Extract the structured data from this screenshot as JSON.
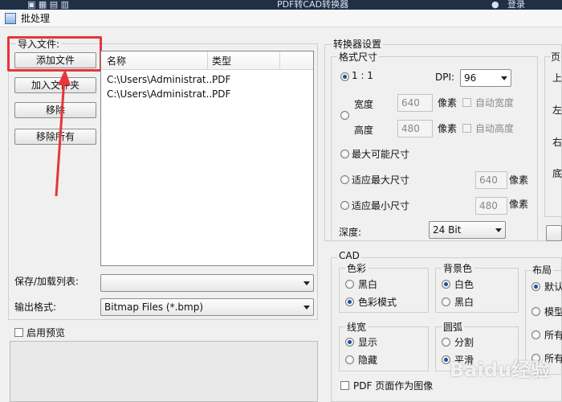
{
  "window": {
    "title_bar_text": "PDF转CAD转换器",
    "title_bar_user": "登录",
    "dialog_title": "批处理"
  },
  "import_section": {
    "title": "导入文件:",
    "buttons": {
      "add_file": "添加文件",
      "add_folder": "加入文件夹",
      "remove": "移除",
      "remove_all": "移除所有"
    }
  },
  "file_list": {
    "columns": [
      "名称",
      "类型"
    ],
    "rows": [
      {
        "name": "C:\\Users\\Administrat...",
        "type": "PDF"
      },
      {
        "name": "C:\\Users\\Administrat...",
        "type": "PDF"
      }
    ]
  },
  "list_controls": {
    "save_load_label": "保存/加载列表:",
    "save_load_value": "",
    "output_format_label": "输出格式:",
    "output_format_value": "Bitmap Files (*.bmp)"
  },
  "preview": {
    "enable_label": "启用预览"
  },
  "converter": {
    "title": "转换器设置",
    "format_size": {
      "title": "格式尺寸",
      "ratio_label": "1 : 1",
      "dpi_label": "DPI:",
      "dpi_value": "96",
      "width_label": "宽度",
      "width_value": "640",
      "width_unit": "像素",
      "auto_width": "自动宽度",
      "height_label": "高度",
      "height_value": "480",
      "height_unit": "像素",
      "auto_height": "自动高度",
      "max_possible": "最大可能尺寸",
      "fit_max": "适应最大尺寸",
      "fit_max_value": "640",
      "fit_max_unit": "像素",
      "fit_min": "适应最小尺寸",
      "fit_min_value": "480",
      "fit_min_unit": "像素",
      "depth_label": "深度:",
      "depth_value": "24 Bit"
    },
    "page_partial": {
      "title": "页",
      "top": "上",
      "left": "左",
      "right": "右",
      "bottom": "底"
    }
  },
  "cad": {
    "title": "CAD",
    "color": {
      "title": "色彩",
      "mono": "黑白",
      "color_mode": "色彩模式"
    },
    "background": {
      "title": "背景色",
      "white": "白色",
      "black": "黑白"
    },
    "layout": {
      "title": "布局",
      "default": "默认",
      "model": "模型",
      "all1": "所有",
      "all2": "所有"
    },
    "linewidth": {
      "title": "线宽",
      "show": "显示",
      "hide": "隐藏"
    },
    "arc": {
      "title": "圆弧",
      "split": "分割",
      "smooth": "平滑"
    },
    "pdf_page_as_image": "PDF 页面作为图像"
  },
  "watermark": "Baidu经验",
  "colors": {
    "highlight": "#e8343a",
    "arrow": "#e8343a",
    "accent_radio": "#1e4fa1"
  }
}
